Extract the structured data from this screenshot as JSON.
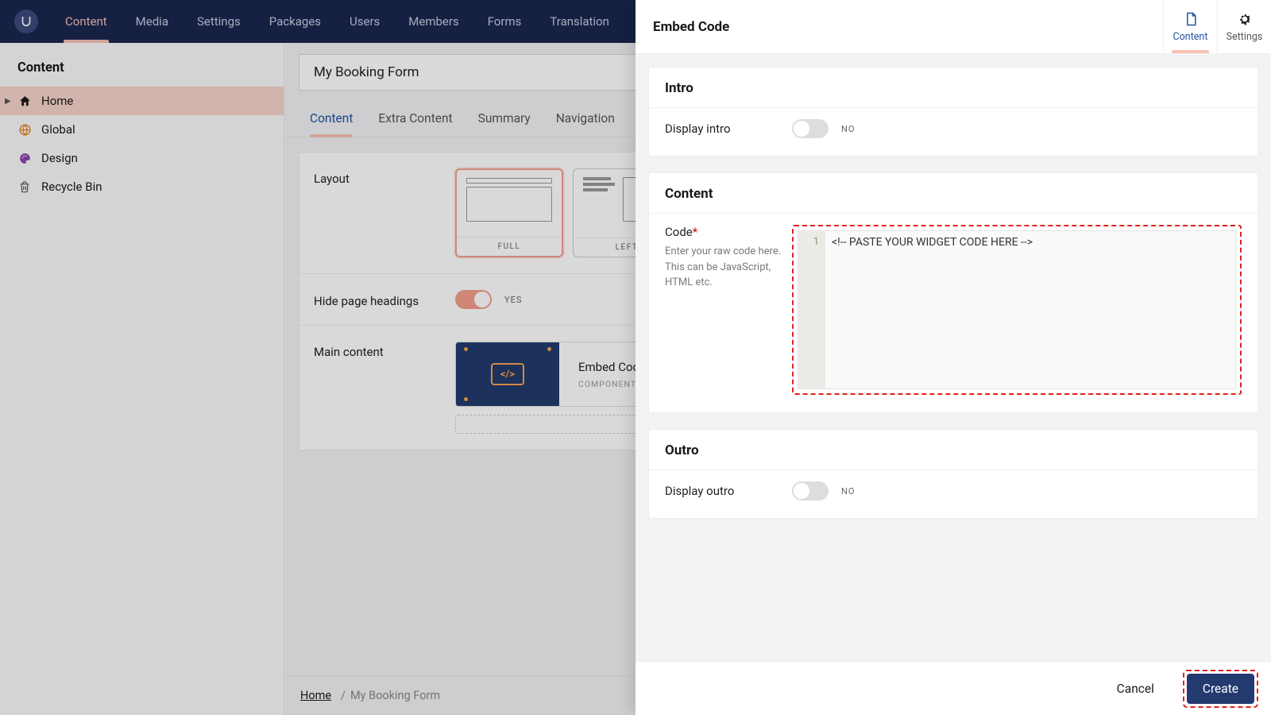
{
  "nav": {
    "items": [
      "Content",
      "Media",
      "Settings",
      "Packages",
      "Users",
      "Members",
      "Forms",
      "Translation"
    ],
    "active": 0
  },
  "sidebar": {
    "title": "Content",
    "items": [
      {
        "label": "Home",
        "icon": "home",
        "active": true,
        "hasCaret": true
      },
      {
        "label": "Global",
        "icon": "globe"
      },
      {
        "label": "Design",
        "icon": "palette"
      },
      {
        "label": "Recycle Bin",
        "icon": "trash"
      }
    ]
  },
  "page": {
    "title": "My Booking Form",
    "tabs": [
      "Content",
      "Extra Content",
      "Summary",
      "Navigation"
    ],
    "activeTab": 0,
    "layout_label": "Layout",
    "layout_options": [
      "FULL",
      "LEFT"
    ],
    "layout_selected": 0,
    "hideheadings_label": "Hide page headings",
    "hideheadings_value": "YES",
    "maincontent_label": "Main content",
    "embed_title": "Embed Code",
    "embed_sub": "COMPONENT"
  },
  "breadcrumb": {
    "root": "Home",
    "sep": "/",
    "current": "My Booking Form"
  },
  "panel": {
    "title": "Embed Code",
    "tabs": [
      "Content",
      "Settings"
    ],
    "activeTab": 0,
    "intro": {
      "heading": "Intro",
      "label": "Display intro",
      "value": "NO"
    },
    "content": {
      "heading": "Content",
      "code_label": "Code",
      "code_help": "Enter your raw code here. This can be JavaScript, HTML etc.",
      "line_no": "1",
      "code_value": "<!-- PASTE YOUR WIDGET CODE HERE -->"
    },
    "outro": {
      "heading": "Outro",
      "label": "Display outro",
      "value": "NO"
    },
    "cancel": "Cancel",
    "create": "Create"
  }
}
